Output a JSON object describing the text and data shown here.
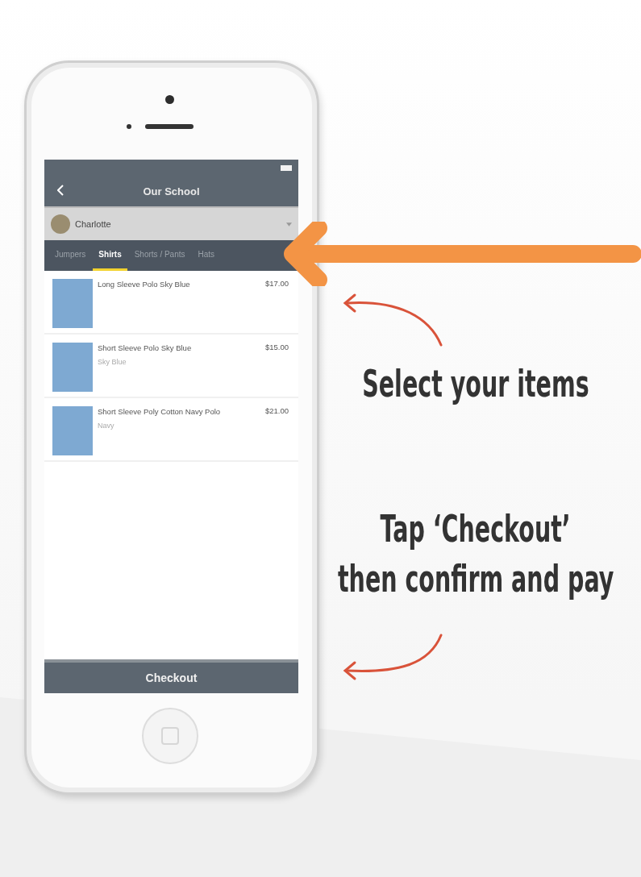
{
  "nav_bar": {
    "title": "Our School"
  },
  "profile": {
    "name": "Charlotte"
  },
  "tabs": [
    {
      "label": "Jumpers",
      "selected": false
    },
    {
      "label": "Shirts",
      "selected": true
    },
    {
      "label": "Shorts / Pants",
      "selected": false
    },
    {
      "label": "Hats",
      "selected": false
    }
  ],
  "items": [
    {
      "name": "Long Sleeve Polo Sky Blue",
      "price": "$17.00"
    },
    {
      "name": "Short Sleeve Polo Sky Blue",
      "price": "$15.00",
      "variant": "Sky Blue"
    },
    {
      "name": "Short Sleeve Poly Cotton Navy Polo",
      "price": "$21.00",
      "variant": "Navy"
    }
  ],
  "checkout_button": {
    "label": "Checkout"
  },
  "captions": [
    "Select your items",
    "Tap ‘Checkout’",
    "then confirm and pay"
  ]
}
